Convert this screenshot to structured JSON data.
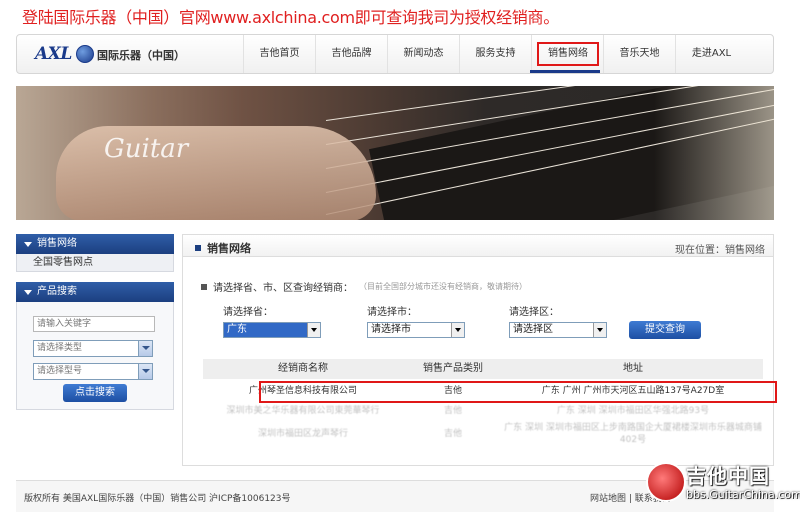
{
  "top_note": {
    "prefix": "登陆国际乐器（中国）官网",
    "site": "www.axlchina.com",
    "suffix": "即可查询我司为授权经销商。"
  },
  "header": {
    "logo_text": "AXL",
    "company_name": "国际乐器（中国）",
    "nav": [
      {
        "label": "吉他首页"
      },
      {
        "label": "吉他品牌"
      },
      {
        "label": "新闻动态"
      },
      {
        "label": "服务支持"
      },
      {
        "label": "销售网络",
        "active": true
      },
      {
        "label": "音乐天地"
      },
      {
        "label": "走进AXL"
      }
    ]
  },
  "banner": {
    "script_text": "Guitar"
  },
  "sidebar": {
    "sales_network": {
      "title": "销售网络",
      "link": "全国零售网点"
    },
    "product_search": {
      "title": "产品搜索",
      "keyword_placeholder": "请输入关键字",
      "type_select": "请选择类型",
      "model_select": "请选择型号",
      "button": "点击搜索"
    }
  },
  "main": {
    "title": "销售网络",
    "breadcrumb": "现在位置：销售网络",
    "query_text": "请选择省、市、区查询经销商：",
    "query_hint": "（目前全国部分城市还没有经销商，敬请期待）",
    "selectors": [
      {
        "label": "请选择省：",
        "value": "广东"
      },
      {
        "label": "请选择市：",
        "value": "请选择市"
      },
      {
        "label": "请选择区：",
        "value": "请选择区"
      }
    ],
    "submit": "提交查询",
    "table": {
      "headers": [
        "经销商名称",
        "销售产品类别",
        "地址"
      ],
      "rows": [
        {
          "name": "广州琴圣信息科技有限公司",
          "category": "吉他",
          "address": "广东 广州 广州市天河区五山路137号A27D室"
        },
        {
          "name": "深圳市美之华乐器有限公司東莞華琴行",
          "category": "吉他",
          "address": "广东 深圳 深圳市福田区华强北路93号"
        },
        {
          "name": "深圳市福田区龙声琴行",
          "category": "吉他",
          "address": "广东 深圳 深圳市福田区上步南路国企大厦裙楼深圳市乐器城商铺402号"
        }
      ]
    }
  },
  "footer": {
    "copyright": "版权所有 美国AXL国际乐器（中国）销售公司 沪ICP备1006123号",
    "links": "网站地图 | 联系我们"
  },
  "watermark": {
    "title": "吉他中国",
    "url": "bbs.GuitarChina.com"
  }
}
